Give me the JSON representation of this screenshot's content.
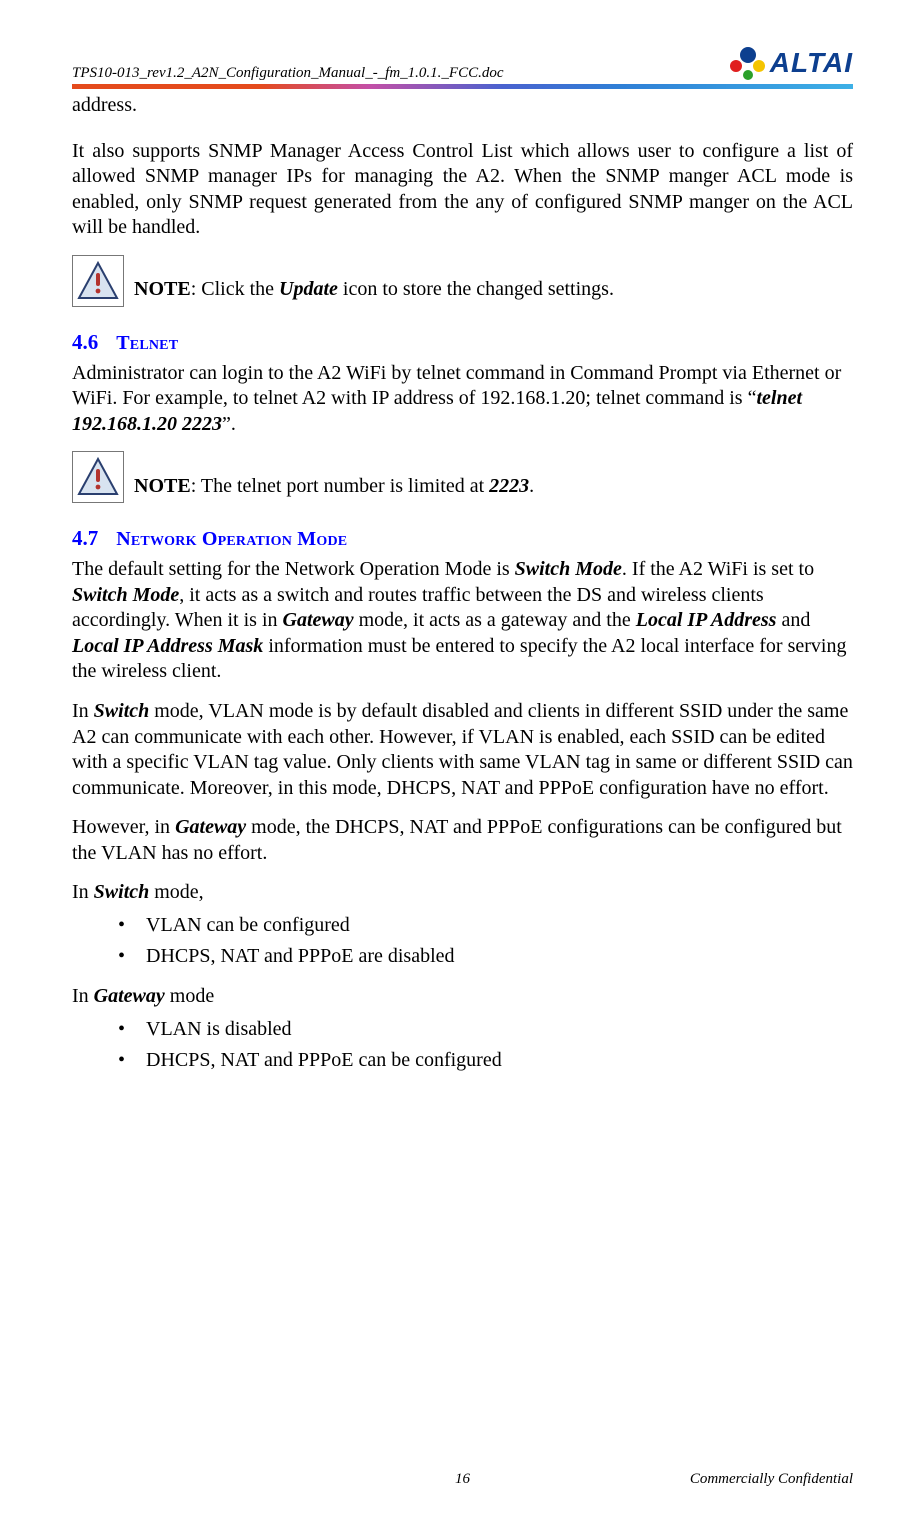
{
  "header": {
    "doc_id": "TPS10-013_rev1.2_A2N_Configuration_Manual_-_fm_1.0.1._FCC.doc",
    "logo_text": "ALTAI"
  },
  "intro": {
    "fragment": "address.",
    "snmp_para": "It also supports SNMP Manager Access Control List which allows user to configure a list of allowed SNMP manager IPs for managing the A2. When the SNMP manger ACL mode is enabled, only SNMP request generated from the any of configured SNMP manger on the ACL will be handled.",
    "note1_label": "NOTE",
    "note1_prefix": ": Click the ",
    "note1_term": "Update",
    "note1_suffix": " icon to store the changed settings."
  },
  "s46": {
    "num": "4.6",
    "title": "Telnet",
    "para_pre": "Administrator can login to the A2 WiFi by telnet command in Command Prompt via Ethernet or WiFi. For example, to telnet A2 with IP address of 192.168.1.20; telnet command is “",
    "cmd": "telnet 192.168.1.20 2223",
    "para_post": "”.",
    "note2_label": "NOTE",
    "note2_prefix": ": The telnet port number is limited at ",
    "note2_port": "2223",
    "note2_suffix": "."
  },
  "s47": {
    "num": "4.7",
    "title": "Network Operation Mode",
    "p1_a": "The default setting for the Network Operation Mode is ",
    "p1_sm": "Switch Mode",
    "p1_b": ". If the A2 WiFi is set to ",
    "p1_c": ", it acts as a switch and routes traffic between the DS and wireless clients accordingly. When it is in ",
    "p1_gw": "Gateway",
    "p1_d": " mode, it acts as a gateway and the ",
    "p1_lip": "Local IP Address",
    "p1_e": " and ",
    "p1_lipm": "Local IP Address Mask",
    "p1_f": " information must be entered to specify the A2 local interface for serving the wireless client.",
    "p2_a": "In ",
    "p2_sw": "Switch",
    "p2_b": " mode, VLAN mode is by default disabled and clients in different SSID under the same A2 can communicate with each other. However, if VLAN is enabled, each SSID can be edited with a specific VLAN tag value. Only clients with same VLAN tag in same or different SSID can communicate. Moreover, in this mode, DHCPS, NAT and PPPoE configuration have no effort.",
    "p3_a": "However, in ",
    "p3_b": " mode, the DHCPS, NAT and PPPoE configurations can be configured but the VLAN has no effort.",
    "p4_a": "In ",
    "p4_b": " mode,",
    "sw_b1": "VLAN can be configured",
    "sw_b2": "DHCPS, NAT and PPPoE are disabled",
    "p5_a": "In ",
    "p5_b": " mode",
    "gw_b1": "VLAN is disabled",
    "gw_b2": "DHCPS, NAT and PPPoE can be configured"
  },
  "footer": {
    "page": "16",
    "conf": "Commercially Confidential"
  }
}
